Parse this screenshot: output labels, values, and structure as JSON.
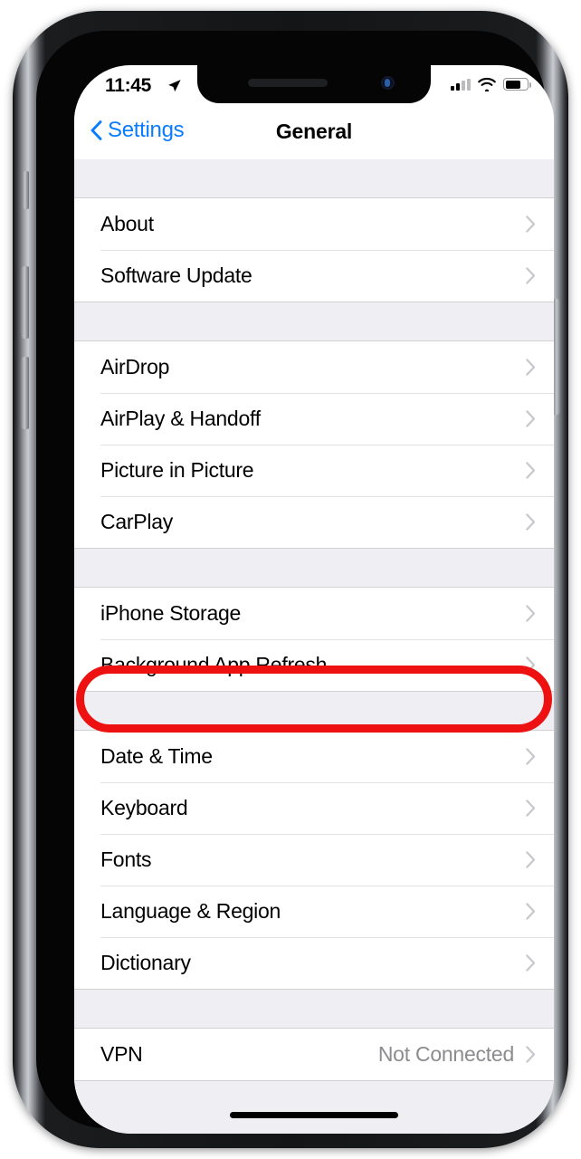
{
  "status_bar": {
    "time": "11:45",
    "location_icon": "location-arrow-icon",
    "signal_icon": "cellular-signal-icon",
    "wifi_icon": "wifi-icon",
    "battery_icon": "battery-icon",
    "battery_level_percent": 62
  },
  "nav_bar": {
    "back_label": "Settings",
    "back_icon": "chevron-left-icon",
    "title": "General"
  },
  "colors": {
    "accent_blue": "#0a7cff",
    "annotation_red": "#ee1111",
    "group_background": "#eeeef3",
    "row_background": "#ffffff",
    "secondary_text": "#8b8b90",
    "chevron": "#c7c7cc"
  },
  "annotation": {
    "shape": "rounded-rectangle-outline",
    "color": "#ee1111",
    "target_row": "Date & Time"
  },
  "groups": [
    {
      "rows": [
        {
          "label": "About",
          "value": "",
          "accessory": "chevron-right-icon"
        },
        {
          "label": "Software Update",
          "value": "",
          "accessory": "chevron-right-icon"
        }
      ]
    },
    {
      "rows": [
        {
          "label": "AirDrop",
          "value": "",
          "accessory": "chevron-right-icon"
        },
        {
          "label": "AirPlay & Handoff",
          "value": "",
          "accessory": "chevron-right-icon"
        },
        {
          "label": "Picture in Picture",
          "value": "",
          "accessory": "chevron-right-icon"
        },
        {
          "label": "CarPlay",
          "value": "",
          "accessory": "chevron-right-icon"
        }
      ]
    },
    {
      "rows": [
        {
          "label": "iPhone Storage",
          "value": "",
          "accessory": "chevron-right-icon"
        },
        {
          "label": "Background App Refresh",
          "value": "",
          "accessory": "chevron-right-icon"
        }
      ]
    },
    {
      "rows": [
        {
          "label": "Date & Time",
          "value": "",
          "accessory": "chevron-right-icon",
          "highlighted": true
        },
        {
          "label": "Keyboard",
          "value": "",
          "accessory": "chevron-right-icon"
        },
        {
          "label": "Fonts",
          "value": "",
          "accessory": "chevron-right-icon"
        },
        {
          "label": "Language & Region",
          "value": "",
          "accessory": "chevron-right-icon"
        },
        {
          "label": "Dictionary",
          "value": "",
          "accessory": "chevron-right-icon"
        }
      ]
    },
    {
      "rows": [
        {
          "label": "VPN",
          "value": "Not Connected",
          "accessory": "chevron-right-icon"
        }
      ]
    }
  ],
  "hardware": {
    "mute_switch": "mute-switch",
    "volume_up": "volume-up-button",
    "volume_down": "volume-down-button",
    "power": "power-button",
    "home_indicator": "home-indicator"
  }
}
